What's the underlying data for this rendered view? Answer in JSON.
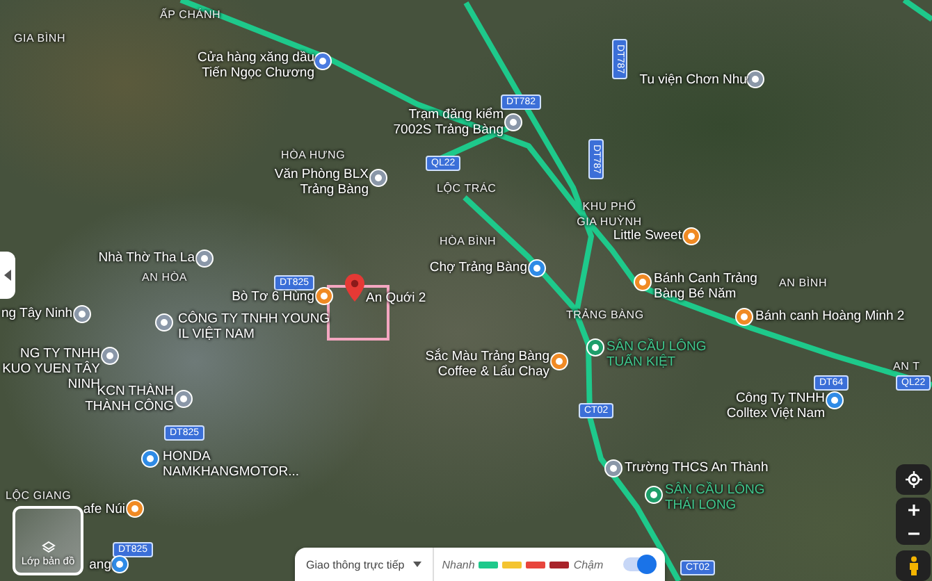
{
  "map": {
    "places": [
      {
        "kind": "area",
        "text": "ẤP CHÁNH"
      },
      {
        "kind": "area",
        "text": "GIA BÌNH"
      },
      {
        "kind": "road_v",
        "text": "DT787"
      },
      {
        "kind": "poi",
        "text": "Cửa hàng xăng dầu Tiến Ngọc Chương",
        "color": "#4a7be0"
      },
      {
        "kind": "poi",
        "text": "Tu viện Chơn Như",
        "color": "#8a97a8"
      },
      {
        "kind": "road",
        "text": "DT782"
      },
      {
        "kind": "poi",
        "text": "Trạm đăng kiểm 7002S Trảng Bàng",
        "color": "#8a97a8"
      },
      {
        "kind": "road_v",
        "text": "DT787"
      },
      {
        "kind": "area",
        "text": "HÒA HƯNG"
      },
      {
        "kind": "road",
        "text": "QL22"
      },
      {
        "kind": "poi",
        "text": "Văn Phòng BLX Trảng Bàng",
        "color": "#8a97a8"
      },
      {
        "kind": "area",
        "text": "LỘC TRÁC"
      },
      {
        "kind": "area",
        "text": "KHU PHỐ GIA HUỲNH"
      },
      {
        "kind": "area",
        "text": "HÒA BÌNH"
      },
      {
        "kind": "poi",
        "text": "Little Sweet",
        "color": "#f08a24"
      },
      {
        "kind": "poi",
        "text": "Nhà Thờ Tha La",
        "color": "#8a97a8"
      },
      {
        "kind": "poi",
        "text": "Chợ Trảng Bàng",
        "color": "#2f8be6"
      },
      {
        "kind": "area",
        "text": "AN HÒA"
      },
      {
        "kind": "road",
        "text": "DT825"
      },
      {
        "kind": "poi",
        "text": "Bánh Canh Trảng Bàng Bé Năm",
        "color": "#f08a24"
      },
      {
        "kind": "area",
        "text": "AN BÌNH"
      },
      {
        "kind": "poi",
        "text": "Bò Tơ 6 Hùng",
        "color": "#f08a24"
      },
      {
        "kind": "pin",
        "text": "An Quới 2",
        "color": "#e53935"
      },
      {
        "kind": "poi",
        "text": "ng Tây Ninh",
        "color": "#8a97a8"
      },
      {
        "kind": "poi",
        "text": "CÔNG TY TNHH YOUNG IL VIỆT NAM",
        "color": "#8a97a8"
      },
      {
        "kind": "area",
        "text": "TRẢNG BÀNG"
      },
      {
        "kind": "poi",
        "text": "Bánh canh Hoàng Minh 2",
        "color": "#f08a24"
      },
      {
        "kind": "poi_green",
        "text": "SÂN CẦU LÔNG TUẤN KIỆT",
        "color": "#1e9e6a"
      },
      {
        "kind": "poi",
        "text": "NG TY TNHH KUO YUEN TÂY NINH",
        "color": "#8a97a8"
      },
      {
        "kind": "poi",
        "text": "Sắc Màu Trảng Bàng Coffee & Lẩu Chay",
        "color": "#f08a24"
      },
      {
        "kind": "area",
        "text": "AN T"
      },
      {
        "kind": "road",
        "text": "DT64"
      },
      {
        "kind": "road",
        "text": "QL22"
      },
      {
        "kind": "poi",
        "text": "KCN THÀNH THÀNH CÔNG",
        "color": "#8a97a8"
      },
      {
        "kind": "road",
        "text": "CT02"
      },
      {
        "kind": "poi",
        "text": "Công Ty TNHH Colltex Việt Nam",
        "color": "#2f8be6"
      },
      {
        "kind": "road",
        "text": "DT825"
      },
      {
        "kind": "poi",
        "text": "HONDA NAMKHANGMOTOR...",
        "color": "#2f8be6"
      },
      {
        "kind": "poi",
        "text": "Trường THCS An Thành",
        "color": "#8a97a8"
      },
      {
        "kind": "area",
        "text": "LỘC GIANG"
      },
      {
        "kind": "poi",
        "text": "afe Núi",
        "color": "#f08a24"
      },
      {
        "kind": "poi_green",
        "text": "SÂN CẦU LÔNG THÁI LONG",
        "color": "#1e9e6a"
      },
      {
        "kind": "road",
        "text": "DT825"
      },
      {
        "kind": "poi",
        "text": "ang",
        "color": "#2f8be6"
      },
      {
        "kind": "road",
        "text": "CT02"
      }
    ]
  },
  "layers_button": {
    "label": "Lớp bản đồ"
  },
  "traffic": {
    "label": "Giao thông trực tiếp",
    "on": true,
    "fast": "Nhanh",
    "slow": "Chậm",
    "legend": [
      {
        "color": "#1ec98b"
      },
      {
        "color": "#f4c430"
      },
      {
        "color": "#e8453c"
      },
      {
        "color": "#a8232a"
      }
    ]
  }
}
